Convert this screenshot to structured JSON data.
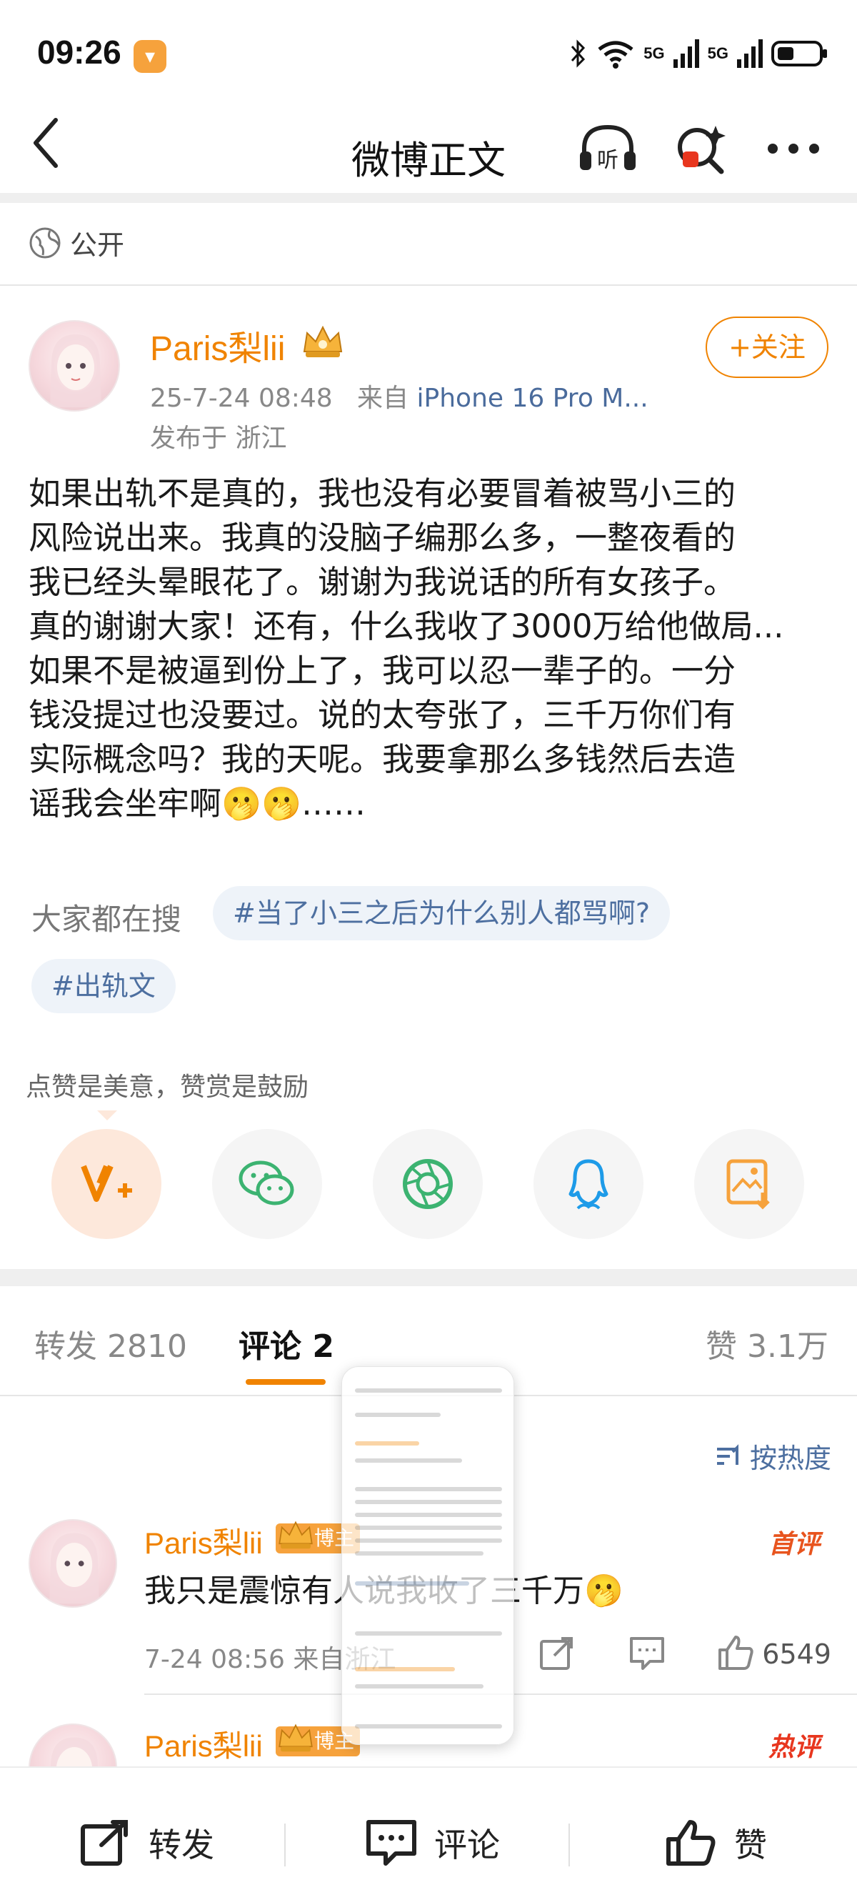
{
  "status": {
    "time": "09:26",
    "sim1": "5G",
    "sim2": "5G"
  },
  "nav": {
    "title": "微博正文",
    "listen_label": "听"
  },
  "visibility": "公开",
  "post": {
    "author": "Paris梨lii",
    "follow_label": "+关注",
    "date": "25-7-24 08:48",
    "source_prefix": "来自",
    "source": "iPhone 16 Pro M...",
    "location": "发布于 浙江",
    "body_lines": [
      "如果出轨不是真的，我也没有必要冒着被骂小三的",
      "风险说出来。我真的没脑子编那么多，一整夜看的",
      "我已经头晕眼花了。谢谢为我说话的所有女孩子。",
      "真的谢谢大家！还有，什么我收了3000万给他做局...",
      "如果不是被逼到份上了，我可以忍一辈子的。一分",
      "钱没提过也没要过。说的太夸张了，三千万你们有",
      "实际概念吗？我的天呢。我要拿那么多钱然后去造",
      "谣我会坐牢啊🫢🫢……"
    ],
    "search_label": "大家都在搜",
    "tags": [
      "#当了小三之后为什么别人都骂啊?",
      "#出轨文"
    ],
    "reward_text": "点赞是美意，赞赏是鼓励",
    "share_icons": [
      "vplus-icon",
      "wechat-icon",
      "moments-icon",
      "qq-icon",
      "save-image-icon"
    ]
  },
  "tabs": {
    "repost": "转发 2810",
    "comment": "评论 2",
    "like": "赞 3.1万"
  },
  "sort_label": "按热度",
  "comments": [
    {
      "name": "Paris梨lii",
      "badge": "博主",
      "hot": "首评",
      "text": "我只是震惊有人说我收了三千万🫢",
      "meta": "7-24 08:56  来自浙江",
      "likes": "6549"
    },
    {
      "name": "Paris梨lii",
      "badge": "博主",
      "hot": "热评"
    }
  ],
  "bottom_bar": {
    "repost": "转发",
    "comment": "评论",
    "like": "赞"
  },
  "colors": {
    "accent": "#f08300",
    "link": "#4d6fa0",
    "hot": "#e8541e"
  }
}
